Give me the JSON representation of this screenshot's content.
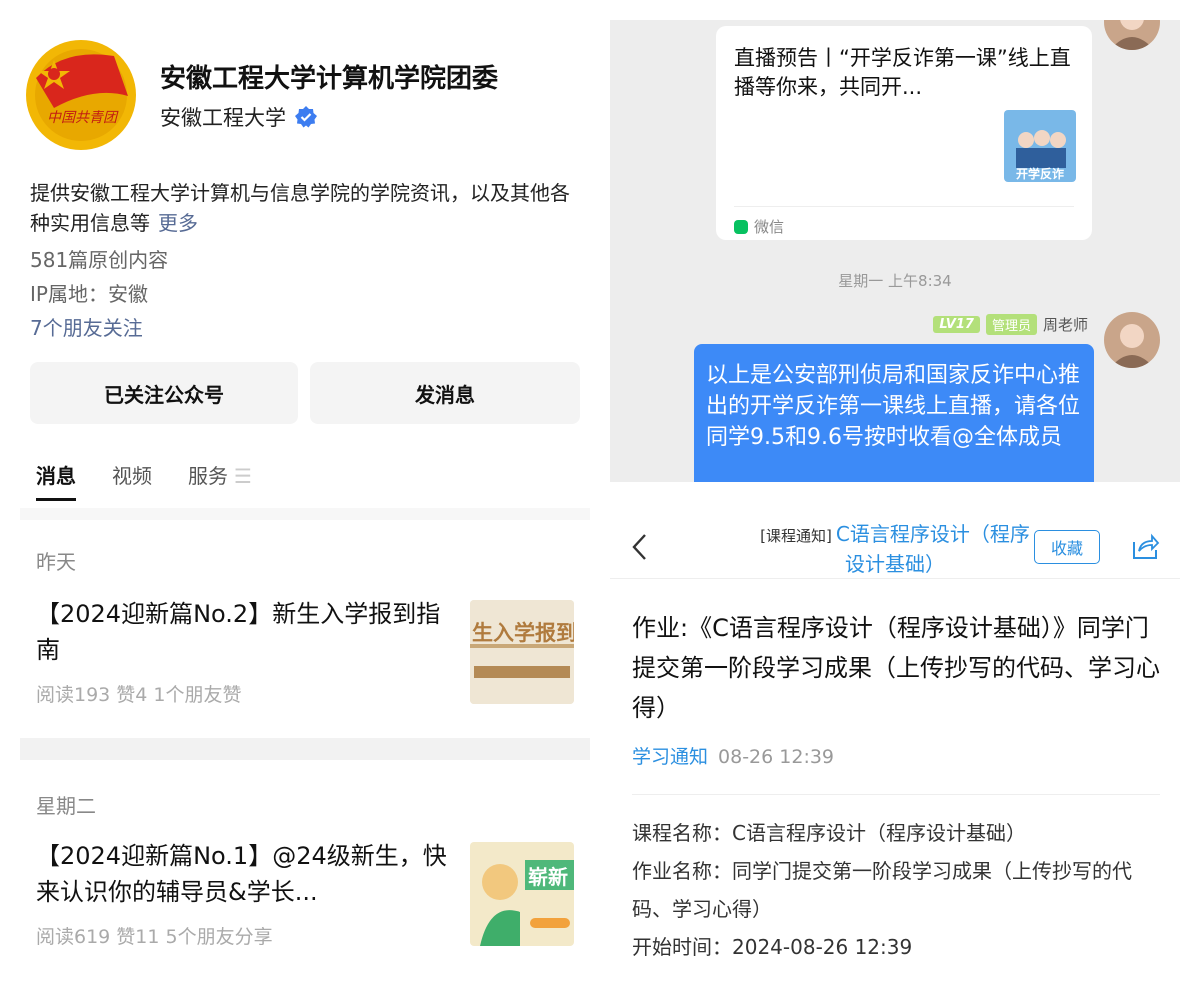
{
  "account": {
    "name": "安徽工程大学计算机学院团委",
    "org": "安徽工程大学",
    "description": "提供安徽工程大学计算机与信息学院的学院资讯，以及其他各种实用信息等",
    "more_label": "更多",
    "original_count": "581篇原创内容",
    "ip_location": "IP属地：安徽",
    "friends_following": "7个朋友关注",
    "logo_text": "中国共青团"
  },
  "buttons": {
    "followed": "已关注公众号",
    "message": "发消息"
  },
  "tabs": [
    {
      "label": "消息",
      "active": true
    },
    {
      "label": "视频",
      "active": false
    },
    {
      "label": "服务",
      "active": false
    }
  ],
  "tab_menu_glyph": "☰",
  "articles": [
    {
      "day": "昨天",
      "title": "【2024迎新篇No.2】新生入学报到指南",
      "stats": "阅读193  赞4  1个朋友赞",
      "thumb_text": "生入学报到指"
    },
    {
      "day": "星期二",
      "title": "【2024迎新篇No.1】@24级新生，快来认识你的辅导员&学长...",
      "stats": "阅读619  赞11  5个朋友分享",
      "thumb_text": "崭新"
    }
  ],
  "chat": {
    "card_title": "直播预告丨“开学反诈第一课”线上直播等你来，共同开...",
    "card_thumb_text": "开学反诈",
    "card_source": "微信",
    "timestamp": "星期一 上午8:34",
    "sender_level": "LV17",
    "sender_role": "管理员",
    "sender_name": "周老师",
    "message": "以上是公安部刑侦局和国家反诈中心推出的开学反诈第一课线上直播，请各位同学9.5和9.6号按时收看@全体成员"
  },
  "assignment": {
    "nav_tag": "[课程通知]",
    "nav_title": "C语言程序设计（程序设计基础）",
    "favorite_label": "收藏",
    "title": "作业:《C语言程序设计（程序设计基础）》同学门提交第一阶段学习成果（上传抄写的代码、学习心得）",
    "category": "学习通知",
    "date": "08-26 12:39",
    "course_name": "课程名称：C语言程序设计（程序设计基础）",
    "homework_name": "作业名称：同学门提交第一阶段学习成果（上传抄写的代码、学习心得）",
    "start_time": "开始时间：2024-08-26 12:39"
  },
  "colors": {
    "link": "#576b95",
    "accent_blue": "#2b8fe0",
    "bubble": "#3d8af7",
    "badge_green": "#b3e07a",
    "wechat_green": "#07c160",
    "chat_bg": "#ededed"
  }
}
